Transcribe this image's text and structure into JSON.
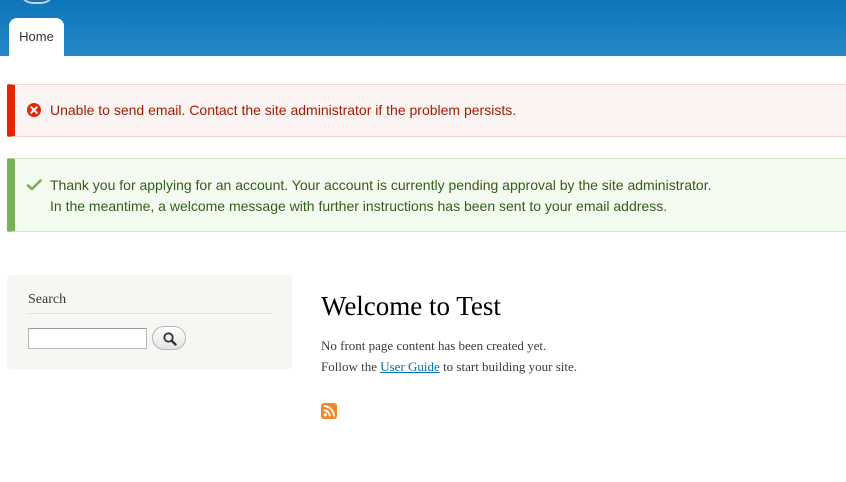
{
  "header": {
    "tabs": [
      {
        "label": "Home",
        "active": true
      }
    ],
    "colors": {
      "top": "#0d75ba",
      "bottom": "#2488c7"
    }
  },
  "messages": {
    "error": {
      "icon": "error-circle-x-icon",
      "text": "Unable to send email. Contact the site administrator if the problem persists."
    },
    "status": {
      "icon": "checkmark-icon",
      "lines": [
        "Thank you for applying for an account. Your account is currently pending approval by the site administrator.",
        "In the meantime, a welcome message with further instructions has been sent to your email address."
      ]
    }
  },
  "sidebar": {
    "search": {
      "title": "Search",
      "input_value": "",
      "button_icon": "magnifier-icon"
    }
  },
  "main": {
    "title": "Welcome to Test",
    "line1": "No front page content has been created yet.",
    "line2_prefix": "Follow the ",
    "line2_link": "User Guide",
    "line2_suffix": " to start building your site.",
    "feed_icon": "rss-feed-icon"
  }
}
